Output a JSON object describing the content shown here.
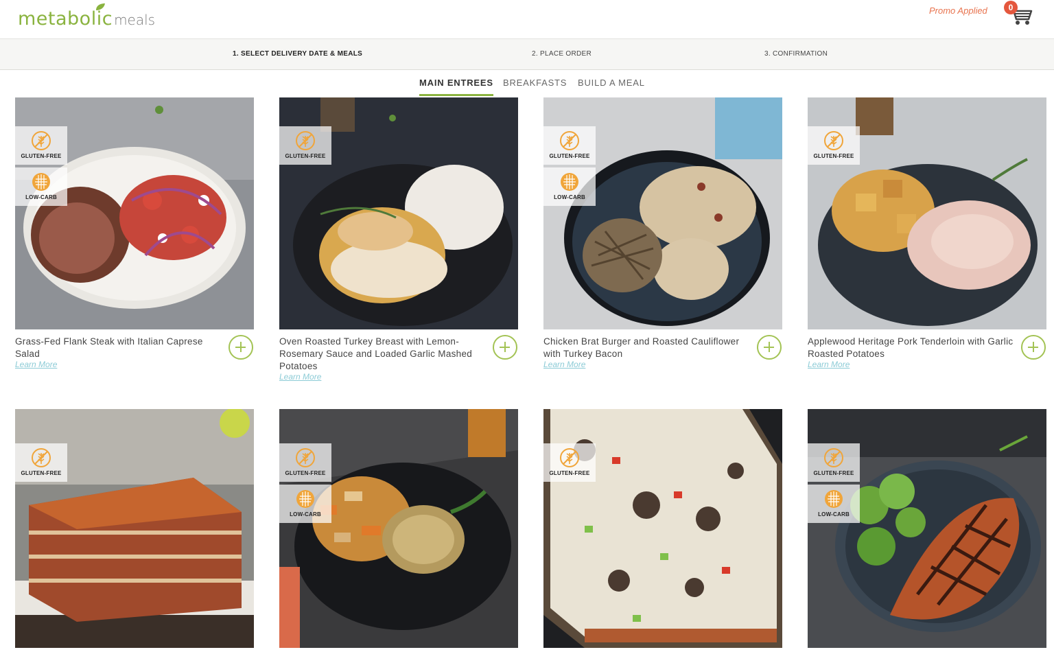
{
  "brand": {
    "logo_main": "metabolic",
    "logo_sub": "meals"
  },
  "header": {
    "promo_text": "Promo Applied",
    "cart_count": "0"
  },
  "steps": [
    {
      "label": "1. SELECT DELIVERY DATE & MEALS",
      "active": true
    },
    {
      "label": "2. PLACE ORDER",
      "active": false
    },
    {
      "label": "3. CONFIRMATION",
      "active": false
    }
  ],
  "tabs": [
    {
      "label": "MAIN ENTREES",
      "active": true
    },
    {
      "label": "BREAKFASTS",
      "active": false
    },
    {
      "label": "BUILD A MEAL",
      "active": false
    }
  ],
  "badges": {
    "gluten_free": "GLUTEN-FREE",
    "low_carb": "LOW-CARB"
  },
  "learn_more": "Learn More",
  "meals": [
    {
      "name": "Grass-Fed Flank Steak with Italian Caprese Salad",
      "tags": [
        "gluten_free",
        "low_carb"
      ]
    },
    {
      "name": "Oven Roasted Turkey Breast with Lemon-Rosemary Sauce and Loaded Garlic Mashed Potatoes",
      "tags": [
        "gluten_free"
      ]
    },
    {
      "name": "Chicken Brat Burger and Roasted Cauliflower with Turkey Bacon",
      "tags": [
        "gluten_free",
        "low_carb"
      ]
    },
    {
      "name": "Applewood Heritage Pork Tenderloin with Garlic Roasted Potatoes",
      "tags": [
        "gluten_free"
      ]
    },
    {
      "name": "",
      "tags": [
        "gluten_free"
      ]
    },
    {
      "name": "",
      "tags": [
        "gluten_free",
        "low_carb"
      ]
    },
    {
      "name": "",
      "tags": [
        "gluten_free"
      ]
    },
    {
      "name": "",
      "tags": [
        "gluten_free",
        "low_carb"
      ]
    }
  ],
  "colors": {
    "brand_green": "#8ab33f",
    "add_green": "#a3c354",
    "promo_orange": "#e8734e",
    "link_blue": "#8ccbd6",
    "badge_red": "#e4573d"
  }
}
